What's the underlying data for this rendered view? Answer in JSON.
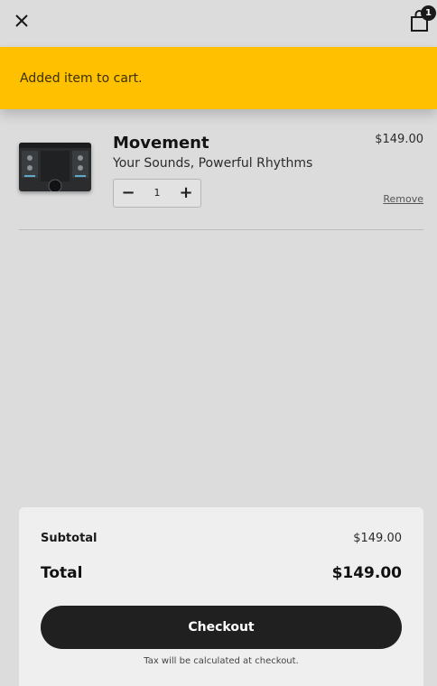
{
  "header": {
    "close_icon": "close-icon",
    "bag_icon": "shopping-bag-icon",
    "bag_count": "1"
  },
  "notification": {
    "text": "Added item to cart.",
    "color": "#ffc000"
  },
  "cart": {
    "items": [
      {
        "title": "Movement",
        "subtitle": "Your Sounds, Powerful Rhythms",
        "price": "$149.00",
        "quantity": "1",
        "decrement_label": "−",
        "increment_label": "+",
        "remove_label": "Remove"
      }
    ]
  },
  "summary": {
    "subtotal_label": "Subtotal",
    "subtotal_value": "$149.00",
    "total_label": "Total",
    "total_value": "$149.00",
    "checkout_label": "Checkout",
    "tax_note": "Tax will be calculated at checkout."
  }
}
